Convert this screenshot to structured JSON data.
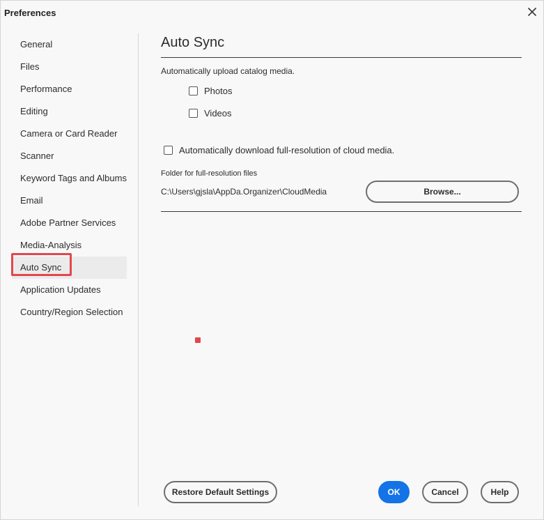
{
  "window": {
    "title": "Preferences"
  },
  "sidebar": {
    "items": [
      {
        "label": "General"
      },
      {
        "label": "Files"
      },
      {
        "label": "Performance"
      },
      {
        "label": "Editing"
      },
      {
        "label": "Camera or Card Reader"
      },
      {
        "label": "Scanner"
      },
      {
        "label": "Keyword Tags and Albums"
      },
      {
        "label": "Email"
      },
      {
        "label": "Adobe Partner Services"
      },
      {
        "label": "Media-Analysis"
      },
      {
        "label": "Auto Sync",
        "selected": true
      },
      {
        "label": "Application Updates"
      },
      {
        "label": "Country/Region Selection"
      }
    ]
  },
  "panel": {
    "title": "Auto Sync",
    "upload_description": "Automatically upload catalog media.",
    "photos_label": "Photos",
    "photos_checked": false,
    "videos_label": "Videos",
    "videos_checked": false,
    "download_label": "Automatically download full-resolution of cloud media.",
    "download_checked": false,
    "folder_label": "Folder for full-resolution files",
    "folder_path": "C:\\Users\\gjsla\\AppDa.Organizer\\CloudMedia",
    "browse_label": "Browse..."
  },
  "footer": {
    "restore_label": "Restore Default Settings",
    "ok_label": "OK",
    "cancel_label": "Cancel",
    "help_label": "Help"
  },
  "colors": {
    "accent": "#1473e6",
    "highlight": "#e2474c"
  }
}
